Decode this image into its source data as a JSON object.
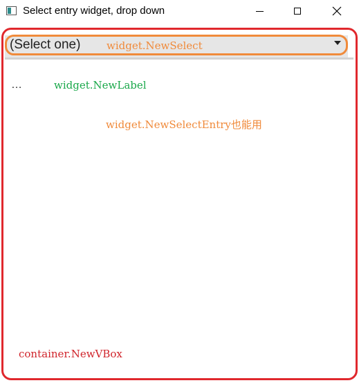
{
  "window": {
    "title": "Select entry widget, drop down",
    "controls": [
      "minimize",
      "maximize",
      "close"
    ]
  },
  "select": {
    "value": "(Select one)"
  },
  "label": {
    "text": "…"
  },
  "annotations": {
    "select": "widget.NewSelect",
    "label": "widget.NewLabel",
    "select_entry": "widget.NewSelectEntry也能用",
    "vbox": "container.NewVBox"
  },
  "colors": {
    "vbox_outline": "#e0282d",
    "select_outline": "#f08a3a",
    "label_annotation": "#1aa84a",
    "select_background": "#e6e6e6"
  }
}
